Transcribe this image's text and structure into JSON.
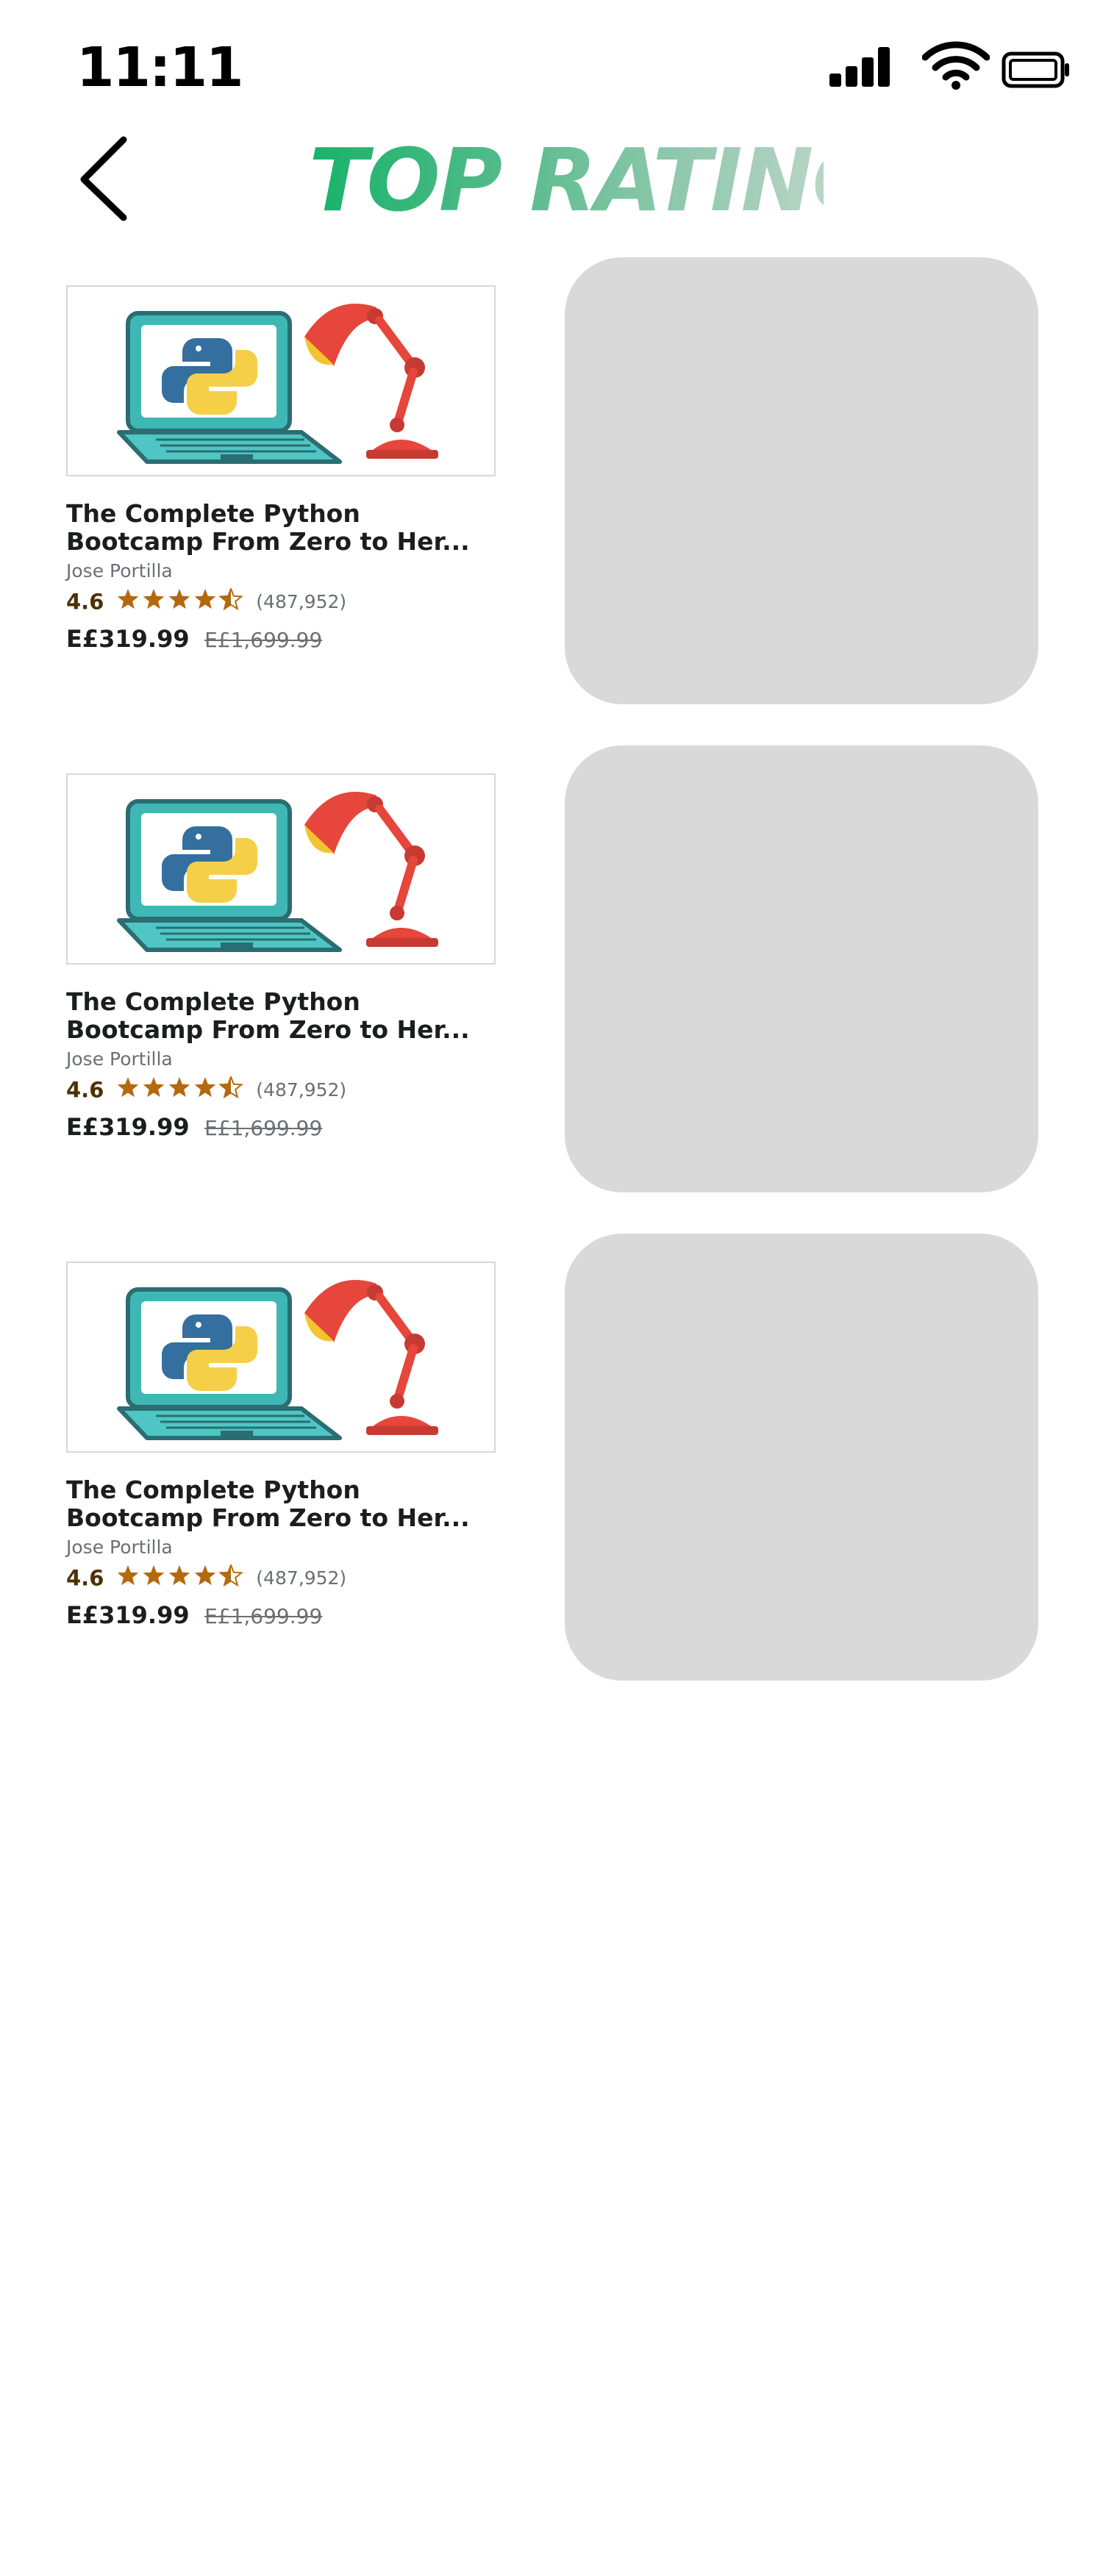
{
  "status_bar": {
    "time": "11:11",
    "icons": [
      "signal-icon",
      "wifi-icon",
      "battery-icon"
    ]
  },
  "header": {
    "back_icon": "chevron-left-icon",
    "title": "TOP RATING",
    "title_gradient": [
      "#17b36a",
      "#b9d4c6"
    ]
  },
  "courses": [
    {
      "title_line1": "The Complete Python",
      "title_line2": "Bootcamp From Zero to Her...",
      "instructor": "Jose Portilla",
      "rating": "4.6",
      "stars": 4.5,
      "reviews": "(487,952)",
      "price": "E£319.99",
      "original_price": "E£1,699.99"
    },
    {
      "title_line1": "The Complete Python",
      "title_line2": "Bootcamp From Zero to Her...",
      "instructor": "Jose Portilla",
      "rating": "4.6",
      "stars": 4.5,
      "reviews": "(487,952)",
      "price": "E£319.99",
      "original_price": "E£1,699.99"
    },
    {
      "title_line1": "The Complete Python",
      "title_line2": "Bootcamp From Zero to Her...",
      "instructor": "Jose Portilla",
      "rating": "4.6",
      "stars": 4.5,
      "reviews": "(487,952)",
      "price": "E£319.99",
      "original_price": "E£1,699.99"
    }
  ],
  "colors": {
    "star": "#b4690e",
    "placeholder": "#d9d9d9",
    "text": "#1c1d1f",
    "muted": "#6a6f73"
  }
}
